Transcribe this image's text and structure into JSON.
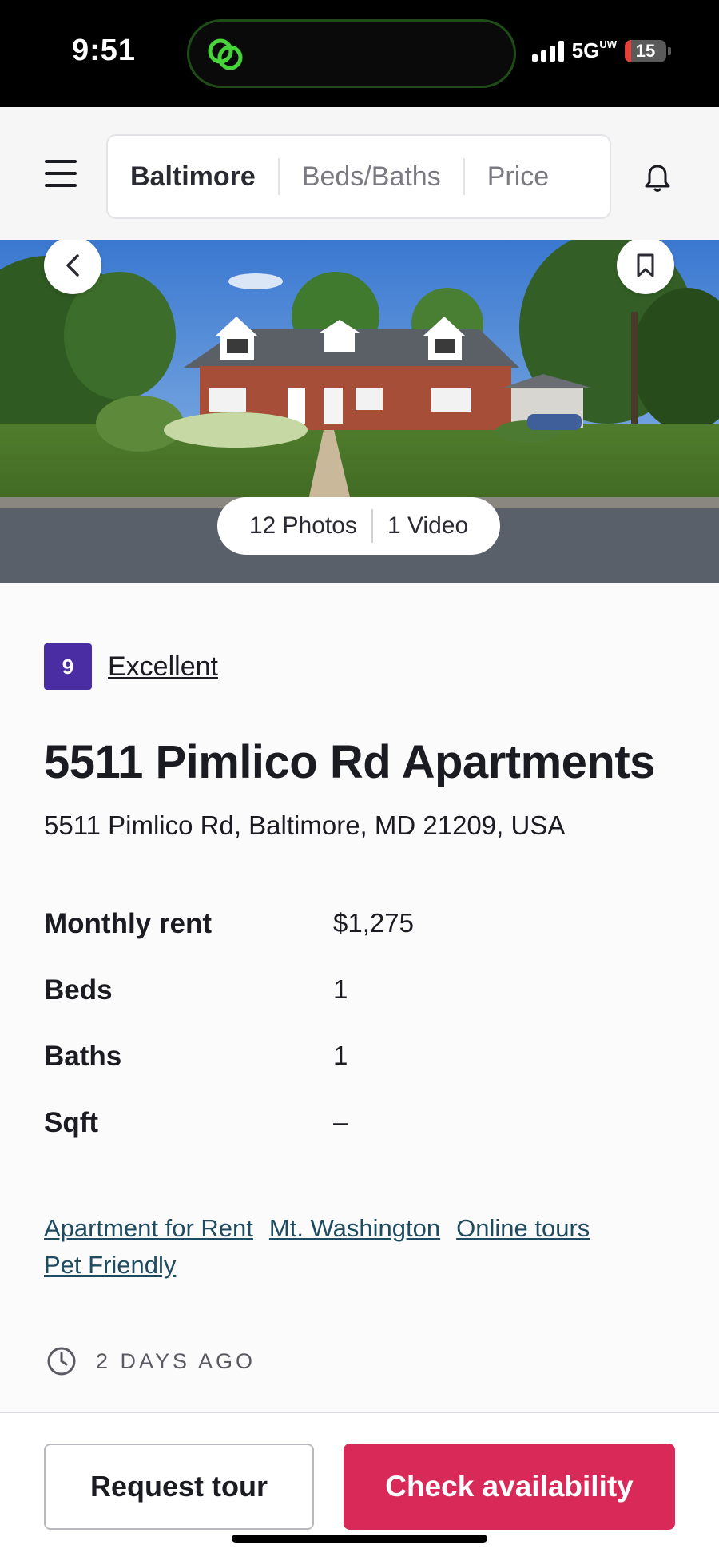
{
  "status_bar": {
    "time": "9:51",
    "network": "5G",
    "network_sub": "UW",
    "battery": "15",
    "battery_level_percent": 15
  },
  "header": {
    "filters": [
      "Baltimore",
      "Beds/Baths",
      "Price"
    ],
    "active_filter": "Baltimore"
  },
  "hero": {
    "photos_label": "12 Photos",
    "video_label": "1 Video"
  },
  "listing": {
    "rating_score": "9",
    "rating_label": "Excellent",
    "title": "5511 Pimlico Rd Apartments",
    "address": "5511 Pimlico Rd, Baltimore, MD 21209, USA",
    "facts": [
      {
        "label": "Monthly rent",
        "value": "$1,275"
      },
      {
        "label": "Beds",
        "value": "1"
      },
      {
        "label": "Baths",
        "value": "1"
      },
      {
        "label": "Sqft",
        "value": "–"
      }
    ],
    "tags": [
      "Apartment for Rent",
      "Mt. Washington",
      "Online tours",
      "Pet Friendly"
    ],
    "posted": "2 DAYS AGO"
  },
  "actions": {
    "request_tour": "Request tour",
    "check_availability": "Check availability"
  },
  "colors": {
    "rating_badge": "#4a2ca3",
    "primary_cta": "#d92958",
    "tag_link": "#1e4b5f",
    "battery_low": "#e3413a"
  },
  "icons": [
    "chat-link-icon",
    "signal-icon",
    "battery-icon",
    "hamburger-menu-icon",
    "bell-icon",
    "chevron-left-icon",
    "bookmark-icon",
    "clock-icon"
  ]
}
